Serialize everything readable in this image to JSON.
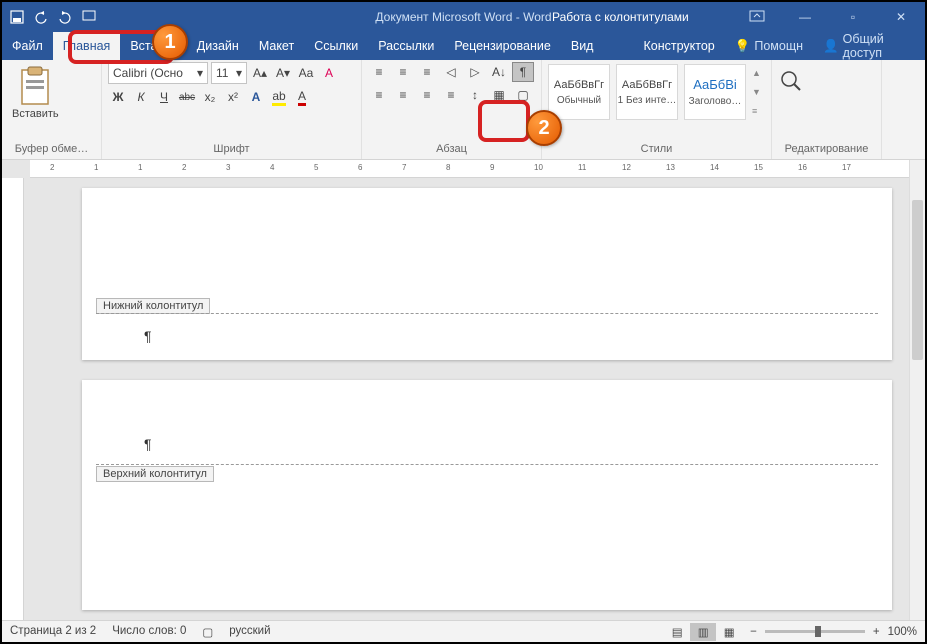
{
  "titlebar": {
    "document_title": "Документ Microsoft Word - Word",
    "context_tab": "Работа с колонтитулами"
  },
  "menu": {
    "file": "Файл",
    "home": "Главная",
    "insert": "Вставка",
    "design": "Дизайн",
    "layout": "Макет",
    "references": "Ссылки",
    "mailings": "Рассылки",
    "review": "Рецензирование",
    "view": "Вид",
    "constructor": "Конструктор",
    "help_placeholder": "Помощн",
    "share": "Общий доступ"
  },
  "ribbon": {
    "clipboard": {
      "paste": "Вставить",
      "group": "Буфер обме…"
    },
    "font": {
      "name": "Calibri (Осно",
      "size": "11",
      "group": "Шрифт",
      "bold": "Ж",
      "italic": "К",
      "underline": "Ч",
      "strike": "abc",
      "sub": "x₂",
      "sup": "x²"
    },
    "paragraph": {
      "group": "Абзац"
    },
    "styles": {
      "group": "Стили",
      "preview": "АаБбВвГг",
      "preview_heading": "АаБбВі",
      "normal": "Обычный",
      "nospacing": "1 Без инте…",
      "heading1": "Заголово…"
    },
    "editing": {
      "group": "Редактирование"
    }
  },
  "document": {
    "footer_label": "Нижний колонтитул",
    "header_label": "Верхний колонтитул",
    "pilcrow": "¶"
  },
  "statusbar": {
    "page": "Страница 2 из 2",
    "words": "Число слов: 0",
    "lang": "русский",
    "zoom": "100%"
  },
  "callouts": {
    "c1": "1",
    "c2": "2"
  },
  "ruler_numbers": [
    "2",
    "1",
    "1",
    "2",
    "3",
    "4",
    "5",
    "6",
    "7",
    "8",
    "9",
    "10",
    "11",
    "12",
    "13",
    "14",
    "15",
    "16",
    "17"
  ]
}
